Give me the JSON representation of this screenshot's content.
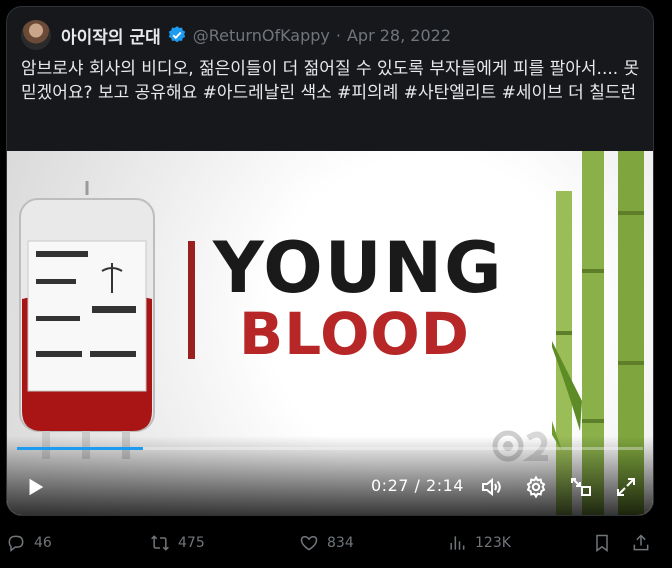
{
  "tweet": {
    "display_name": "아이작의 군대",
    "handle": "@ReturnOfKappy",
    "separator": "·",
    "date": "Apr 28, 2022",
    "text": "암브로샤 회사의 비디오, 젊은이들이 더 젊어질 수 있도록 부자들에게 피를 팔아서.... 못 믿겠어요? 보고 공유해요 #아드레날린 색소 #피의례 #사탄엘리트 #세이브 더 칠드런"
  },
  "video": {
    "title_line1": "YOUNG",
    "title_line2": "BLOOD",
    "current_time": "0:27",
    "separator": "/",
    "duration": "2:14",
    "progress_fraction": 0.202,
    "accent_color": "#1d9bf0",
    "title_red": "#b72727"
  },
  "actions": {
    "replies": "46",
    "retweets": "475",
    "likes": "834",
    "views": "123K"
  },
  "icons": {
    "verified": "verified-badge-icon",
    "play": "play-icon",
    "volume": "volume-icon",
    "settings": "gear-icon",
    "pip": "picture-in-picture-icon",
    "fullscreen": "fullscreen-icon",
    "reply": "reply-icon",
    "retweet": "retweet-icon",
    "like": "heart-icon",
    "views": "views-icon",
    "bookmark": "bookmark-icon",
    "share": "share-icon"
  }
}
